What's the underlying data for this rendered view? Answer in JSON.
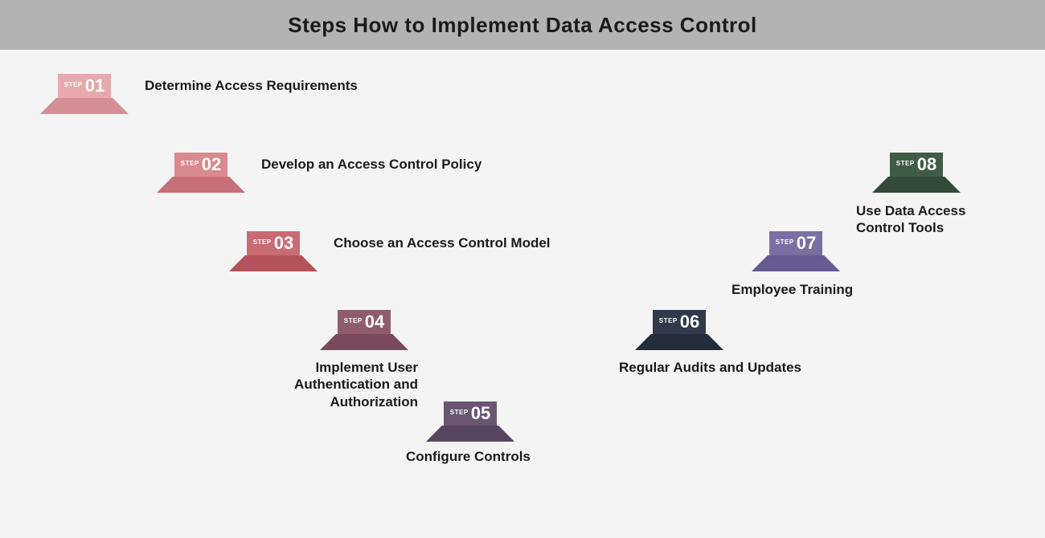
{
  "title": "Steps How to Implement Data Access Control",
  "step_word": "STEP",
  "steps": [
    {
      "num": "01",
      "label": "Determine Access Requirements",
      "top_color": "#e7a9ac",
      "base_color": "#d58e93"
    },
    {
      "num": "02",
      "label": "Develop an Access Control Policy",
      "top_color": "#d98a8f",
      "base_color": "#c66f76"
    },
    {
      "num": "03",
      "label": "Choose an Access Control Model",
      "top_color": "#c96b73",
      "base_color": "#b4525c"
    },
    {
      "num": "04",
      "label": "Implement User Authentication and Authorization",
      "top_color": "#8f5c6e",
      "base_color": "#7a4a5c"
    },
    {
      "num": "05",
      "label": "Configure Controls",
      "top_color": "#6a5670",
      "base_color": "#574560"
    },
    {
      "num": "06",
      "label": "Regular Audits and Updates",
      "top_color": "#2f3a4a",
      "base_color": "#222c3a"
    },
    {
      "num": "07",
      "label": "Employee Training",
      "top_color": "#7a6fa3",
      "base_color": "#665a90"
    },
    {
      "num": "08",
      "label": "Use Data Access Control Tools",
      "top_color": "#3f5c44",
      "base_color": "#324a37"
    }
  ]
}
